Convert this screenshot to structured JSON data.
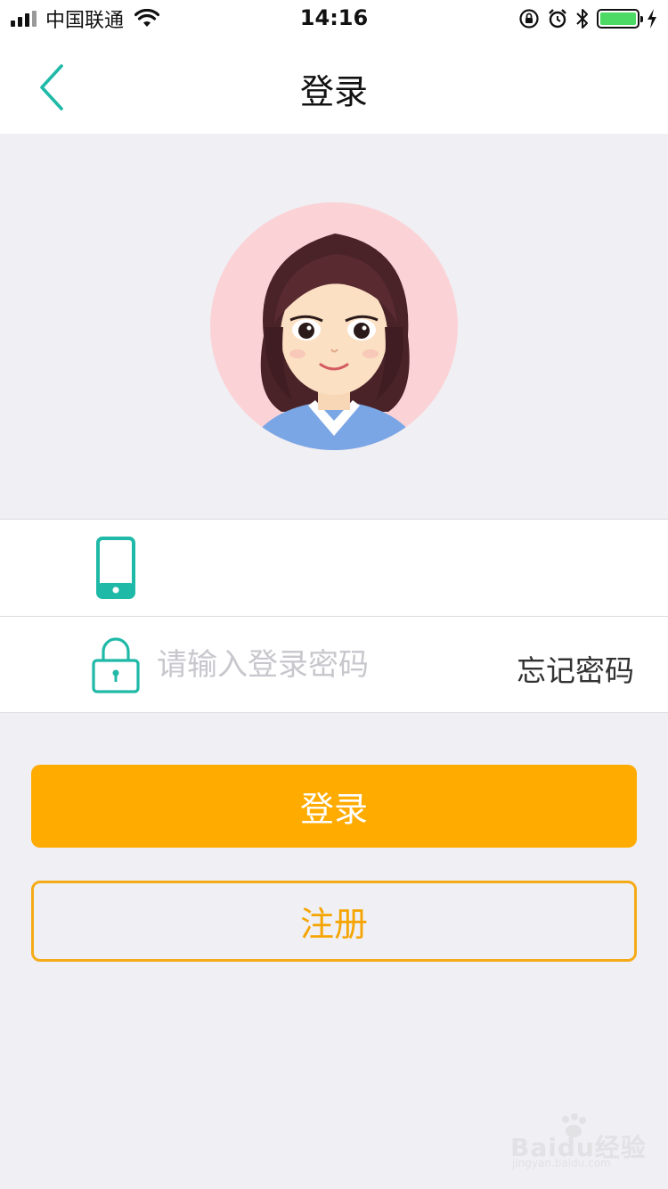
{
  "status_bar": {
    "carrier": "中国联通",
    "time": "14:16",
    "battery_color": "#4cd964"
  },
  "nav": {
    "title": "登录",
    "back_icon": "chevron-left-icon"
  },
  "avatar": {
    "icon": "female-cartoon-avatar"
  },
  "phone_field": {
    "icon": "mobile-phone-icon",
    "value": "",
    "placeholder": ""
  },
  "password_field": {
    "icon": "lock-icon",
    "value": "",
    "placeholder": "请输入登录密码",
    "forgot_label": "忘记密码"
  },
  "buttons": {
    "login_label": "登录",
    "register_label": "注册"
  },
  "watermark": {
    "text": "Baidu经验",
    "subtext": "jingyan.baidu.com"
  },
  "colors": {
    "accent": "#1fb9a8",
    "primary_button": "#ffab00",
    "register_border": "#f5ab17",
    "background": "#efeff4"
  }
}
